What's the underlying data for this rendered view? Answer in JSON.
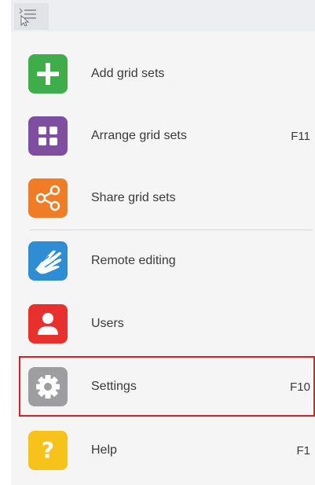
{
  "colors": {
    "add": "#3fae4a",
    "arrange": "#7f4ea0",
    "share": "#f07c26",
    "remote": "#2f8ed3",
    "users": "#e8312f",
    "settings": "#9e9ea0",
    "help": "#f7c21a",
    "highlight": "#d8202a"
  },
  "topbar": {
    "icon": "menu-list-icon"
  },
  "menu": {
    "items": [
      {
        "label": "Add grid sets",
        "shortcut": "",
        "icon": "plus-icon"
      },
      {
        "label": "Arrange grid sets",
        "shortcut": "F11",
        "icon": "grid-icon"
      },
      {
        "label": "Share grid sets",
        "shortcut": "",
        "icon": "share-icon"
      },
      {
        "label": "Remote editing",
        "shortcut": "",
        "icon": "hands-icon"
      },
      {
        "label": "Users",
        "shortcut": "",
        "icon": "user-icon"
      },
      {
        "label": "Settings",
        "shortcut": "F10",
        "icon": "gear-icon"
      },
      {
        "label": "Help",
        "shortcut": "F1",
        "icon": "question-icon",
        "glyph": "?"
      }
    ]
  }
}
